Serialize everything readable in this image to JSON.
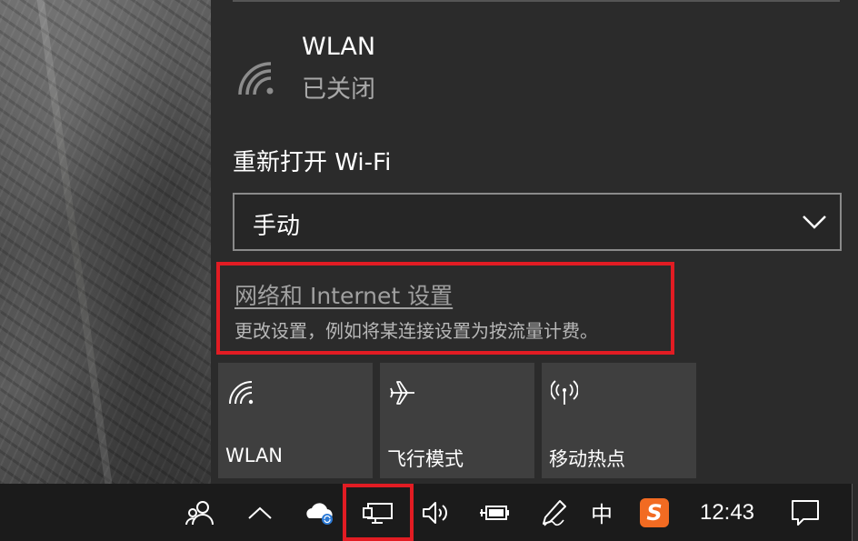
{
  "wlan": {
    "title": "WLAN",
    "status": "已关闭"
  },
  "reopen": {
    "label": "重新打开 Wi-Fi",
    "selected": "手动"
  },
  "network_settings": {
    "link": "网络和 Internet 设置",
    "description": "更改设置，例如将某连接设置为按流量计费。"
  },
  "tiles": [
    {
      "label": "WLAN",
      "icon": "wifi-icon"
    },
    {
      "label": "飞行模式",
      "icon": "airplane-icon"
    },
    {
      "label": "移动热点",
      "icon": "hotspot-icon"
    }
  ],
  "taskbar": {
    "ime": "中",
    "sogou": "S",
    "clock": "12:43",
    "icons": [
      "people-icon",
      "chevron-up-icon",
      "onedrive-icon",
      "network-icon",
      "volume-icon",
      "battery-icon",
      "pen-icon",
      "notification-icon"
    ]
  },
  "colors": {
    "highlight": "#e21c23",
    "panel": "#2b2b2b",
    "tile": "#3f3f3f",
    "sogou": "#f26b22"
  }
}
